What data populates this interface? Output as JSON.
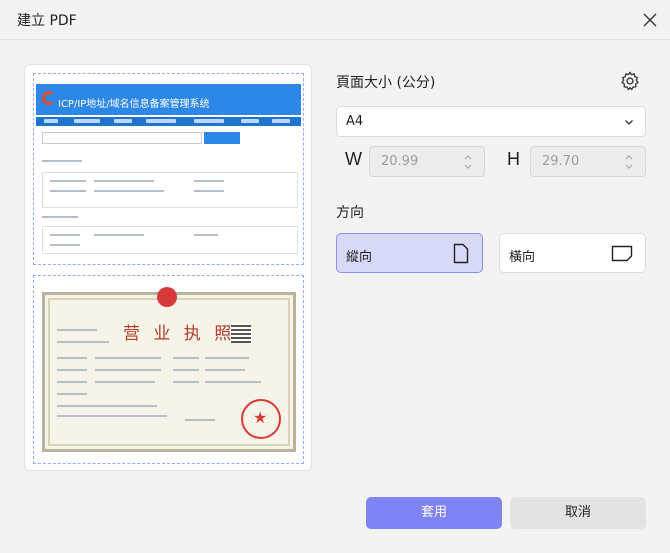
{
  "dialog": {
    "title": "建立 PDF"
  },
  "preview": {
    "page1": {
      "site_title": "ICP/IP地址/域名信息备案管理系统"
    },
    "page2": {
      "certificate_title": "营 业 执 照"
    }
  },
  "page_size": {
    "heading": "頁面大小 (公分)",
    "selected": "A4",
    "width_label": "W",
    "width_value": "20.99",
    "height_label": "H",
    "height_value": "29.70"
  },
  "orientation": {
    "heading": "方向",
    "portrait_label": "縱向",
    "landscape_label": "橫向",
    "selected": "portrait"
  },
  "buttons": {
    "apply": "套用",
    "cancel": "取消"
  },
  "colors": {
    "accent": "#7f83f3",
    "selected_bg": "#d8d9f7",
    "selected_border": "#8c8fed"
  }
}
